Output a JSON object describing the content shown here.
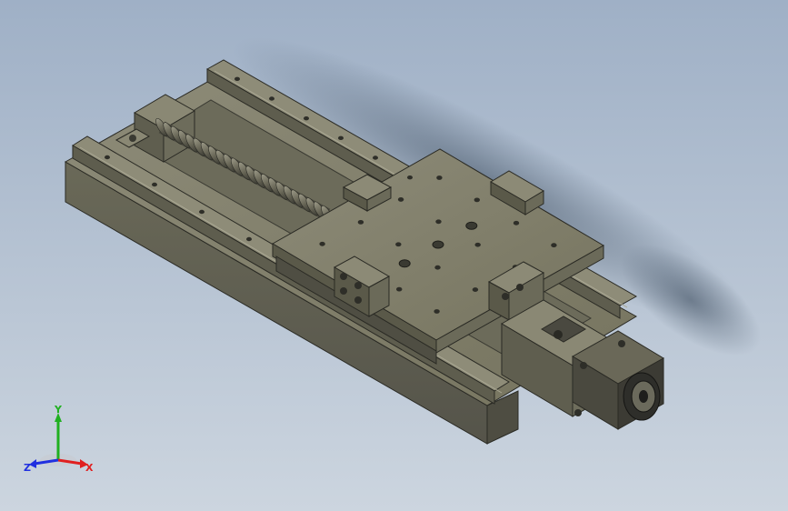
{
  "viewport": {
    "background_top": "#9fb0c6",
    "background_bottom": "#ccd5df"
  },
  "model": {
    "part_color": "#7c7a68",
    "part_dark": "#5a5a4c",
    "part_light": "#9a9884",
    "motor_color": "#3a3a38"
  },
  "triad": {
    "x_label": "X",
    "y_label": "Y",
    "z_label": "Z",
    "x_color": "#e02020",
    "y_color": "#20b020",
    "z_color": "#2030e0"
  }
}
